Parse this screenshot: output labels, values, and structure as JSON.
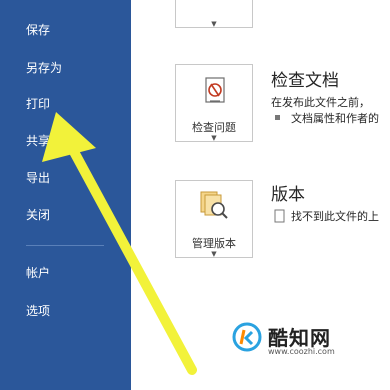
{
  "sidebar": {
    "items": [
      {
        "label": "保存"
      },
      {
        "label": "另存为"
      },
      {
        "label": "打印"
      },
      {
        "label": "共享"
      },
      {
        "label": "导出"
      },
      {
        "label": "关闭"
      },
      {
        "label": "帐户"
      },
      {
        "label": "选项"
      }
    ],
    "highlighted": "打印"
  },
  "inspect": {
    "title": "检查文档",
    "button_label": "检查问题",
    "desc": "在发布此文件之前，",
    "bullet": "文档属性和作者的"
  },
  "versions": {
    "title": "版本",
    "button_label": "管理版本",
    "desc": "找不到此文件的上"
  },
  "watermark": {
    "name": "酷知网",
    "url": "www.coozhi.com"
  },
  "colors": {
    "sidebar": "#2b579a",
    "arrow": "#f2f23a",
    "watermark_accent": "#2aa2e0"
  }
}
